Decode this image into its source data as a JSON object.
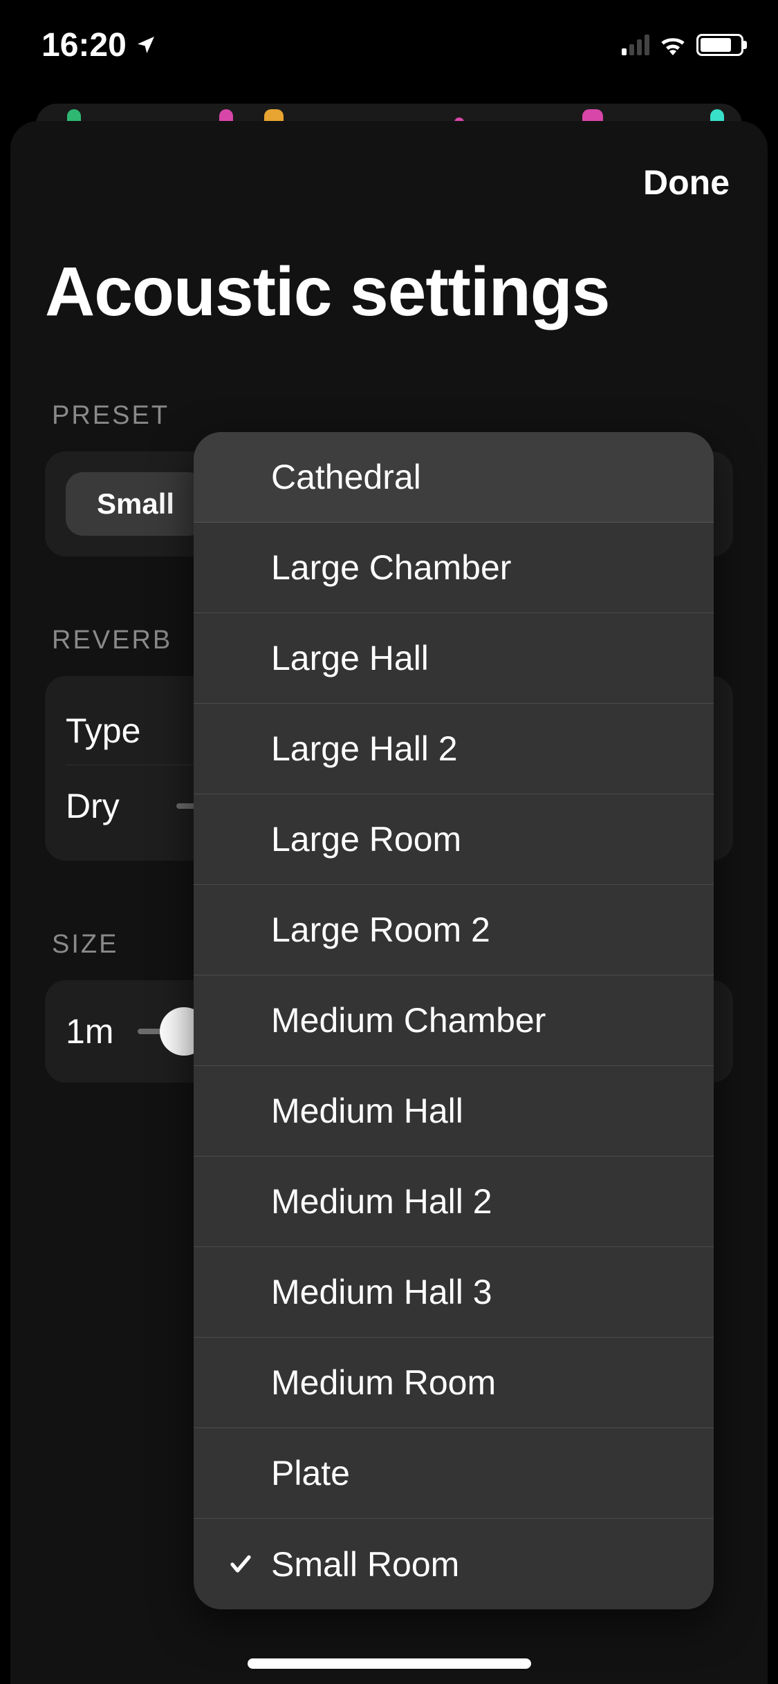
{
  "status": {
    "time": "16:20"
  },
  "sheet": {
    "done_label": "Done",
    "title": "Acoustic settings"
  },
  "preset": {
    "header": "PRESET",
    "selected_label": "Small"
  },
  "reverb": {
    "header": "REVERB",
    "type_label": "Type",
    "dry_label": "Dry"
  },
  "size": {
    "header": "SIZE",
    "min_label": "1m"
  },
  "dropdown": {
    "options": [
      "Cathedral",
      "Large Chamber",
      "Large Hall",
      "Large Hall 2",
      "Large Room",
      "Large Room 2",
      "Medium Chamber",
      "Medium Hall",
      "Medium Hall 2",
      "Medium Hall 3",
      "Medium Room",
      "Plate",
      "Small Room"
    ],
    "selected_index": 12
  },
  "colors": {
    "blob1": "#2eb872",
    "blob2": "#e8a431",
    "blob3": "#d946aa",
    "blob4": "#d946aa",
    "blob5": "#38e0c9"
  }
}
